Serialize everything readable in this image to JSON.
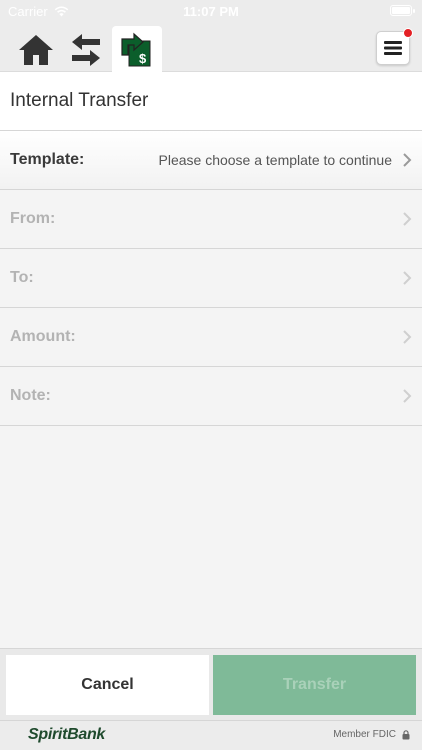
{
  "status_bar": {
    "carrier": "Carrier",
    "time": "11:07 PM"
  },
  "nav": {
    "icons": [
      "home-icon",
      "transfer-arrows-icon",
      "internal-transfer-icon",
      "hamburger-menu-icon"
    ],
    "active": "internal-transfer",
    "notification": true
  },
  "page": {
    "title": "Internal Transfer"
  },
  "form": {
    "template": {
      "label": "Template:",
      "value": "Please choose a template to continue"
    },
    "from": {
      "label": "From:"
    },
    "to": {
      "label": "To:"
    },
    "amount": {
      "label": "Amount:"
    },
    "note": {
      "label": "Note:"
    }
  },
  "buttons": {
    "cancel": "Cancel",
    "transfer": "Transfer"
  },
  "footer": {
    "brand": "SpiritBank",
    "fdic": "Member FDIC"
  },
  "colors": {
    "accent": "#0b5e2b",
    "transfer_button": "#7fba98",
    "notification": "#e32024"
  }
}
